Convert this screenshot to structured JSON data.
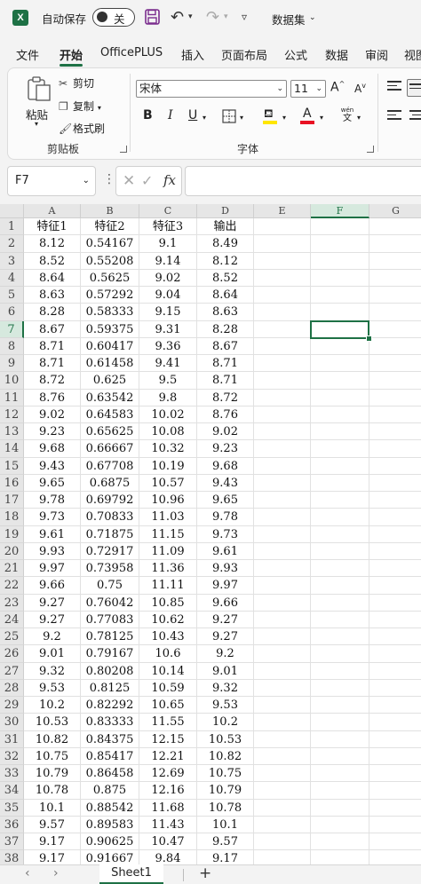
{
  "app_icon": "excel-icon",
  "titlebar": {
    "autosave_label": "自动保存",
    "autosave_state": "关",
    "doc_title": "数据集",
    "icons": [
      "save-icon",
      "undo-icon",
      "redo-icon",
      "customize-icon"
    ]
  },
  "ribbon_tabs": [
    {
      "label": "文件",
      "active": false
    },
    {
      "label": "开始",
      "active": true
    },
    {
      "label": "OfficePLUS",
      "active": false
    },
    {
      "label": "插入",
      "active": false
    },
    {
      "label": "页面布局",
      "active": false
    },
    {
      "label": "公式",
      "active": false
    },
    {
      "label": "数据",
      "active": false
    },
    {
      "label": "审阅",
      "active": false
    },
    {
      "label": "视图",
      "active": false
    }
  ],
  "clipboard": {
    "paste_label": "粘贴",
    "cut_label": "剪切",
    "copy_label": "复制",
    "format_painter_label": "格式刷",
    "group_label": "剪贴板"
  },
  "font": {
    "name": "宋体",
    "size": "11",
    "group_label": "字体",
    "grow_label": "A",
    "shrink_label": "A",
    "bold": "B",
    "italic": "I",
    "underline": "U",
    "font_color_letter": "A",
    "phonetic_top": "wén",
    "phonetic_bottom": "文"
  },
  "formula_bar": {
    "name_box": "F7",
    "fx_label": "fx",
    "value": ""
  },
  "sheet": {
    "columns": [
      "A",
      "B",
      "C",
      "D",
      "E",
      "F",
      "G"
    ],
    "selected_column": "F",
    "selected_row": 7,
    "row_numbers": [
      1,
      2,
      3,
      4,
      5,
      6,
      7,
      8,
      9,
      10,
      11,
      12,
      13,
      14,
      15,
      16,
      17,
      18,
      19,
      20,
      21,
      22,
      23,
      24,
      25,
      26,
      27,
      28,
      29,
      30,
      31,
      32,
      33,
      34,
      35,
      36,
      37,
      38
    ],
    "headers": [
      "特征1",
      "特征2",
      "特征3",
      "输出"
    ],
    "rows": [
      [
        "8.12",
        "0.54167",
        "9.1",
        "8.49"
      ],
      [
        "8.52",
        "0.55208",
        "9.14",
        "8.12"
      ],
      [
        "8.64",
        "0.5625",
        "9.02",
        "8.52"
      ],
      [
        "8.63",
        "0.57292",
        "9.04",
        "8.64"
      ],
      [
        "8.28",
        "0.58333",
        "9.15",
        "8.63"
      ],
      [
        "8.67",
        "0.59375",
        "9.31",
        "8.28"
      ],
      [
        "8.71",
        "0.60417",
        "9.36",
        "8.67"
      ],
      [
        "8.71",
        "0.61458",
        "9.41",
        "8.71"
      ],
      [
        "8.72",
        "0.625",
        "9.5",
        "8.71"
      ],
      [
        "8.76",
        "0.63542",
        "9.8",
        "8.72"
      ],
      [
        "9.02",
        "0.64583",
        "10.02",
        "8.76"
      ],
      [
        "9.23",
        "0.65625",
        "10.08",
        "9.02"
      ],
      [
        "9.68",
        "0.66667",
        "10.32",
        "9.23"
      ],
      [
        "9.43",
        "0.67708",
        "10.19",
        "9.68"
      ],
      [
        "9.65",
        "0.6875",
        "10.57",
        "9.43"
      ],
      [
        "9.78",
        "0.69792",
        "10.96",
        "9.65"
      ],
      [
        "9.73",
        "0.70833",
        "11.03",
        "9.78"
      ],
      [
        "9.61",
        "0.71875",
        "11.15",
        "9.73"
      ],
      [
        "9.93",
        "0.72917",
        "11.09",
        "9.61"
      ],
      [
        "9.97",
        "0.73958",
        "11.36",
        "9.93"
      ],
      [
        "9.66",
        "0.75",
        "11.11",
        "9.97"
      ],
      [
        "9.27",
        "0.76042",
        "10.85",
        "9.66"
      ],
      [
        "9.27",
        "0.77083",
        "10.62",
        "9.27"
      ],
      [
        "9.2",
        "0.78125",
        "10.43",
        "9.27"
      ],
      [
        "9.01",
        "0.79167",
        "10.6",
        "9.2"
      ],
      [
        "9.32",
        "0.80208",
        "10.14",
        "9.01"
      ],
      [
        "9.53",
        "0.8125",
        "10.59",
        "9.32"
      ],
      [
        "10.2",
        "0.82292",
        "10.65",
        "9.53"
      ],
      [
        "10.53",
        "0.83333",
        "11.55",
        "10.2"
      ],
      [
        "10.82",
        "0.84375",
        "12.15",
        "10.53"
      ],
      [
        "10.75",
        "0.85417",
        "12.21",
        "10.82"
      ],
      [
        "10.79",
        "0.86458",
        "12.69",
        "10.75"
      ],
      [
        "10.78",
        "0.875",
        "12.16",
        "10.79"
      ],
      [
        "10.1",
        "0.88542",
        "11.68",
        "10.78"
      ],
      [
        "9.57",
        "0.89583",
        "11.43",
        "10.1"
      ],
      [
        "9.17",
        "0.90625",
        "10.47",
        "9.57"
      ],
      [
        "9.17",
        "0.91667",
        "9.84",
        "9.17"
      ]
    ]
  },
  "sheet_tabs": {
    "tabs": [
      "Sheet1"
    ],
    "add_label": "+",
    "prev_icon": "chevron-left-icon",
    "next_icon": "chevron-right-icon"
  },
  "colors": {
    "accent": "#1e7145",
    "font_color_bar": "#e81123",
    "fill_color_bar": "#ffe600"
  }
}
